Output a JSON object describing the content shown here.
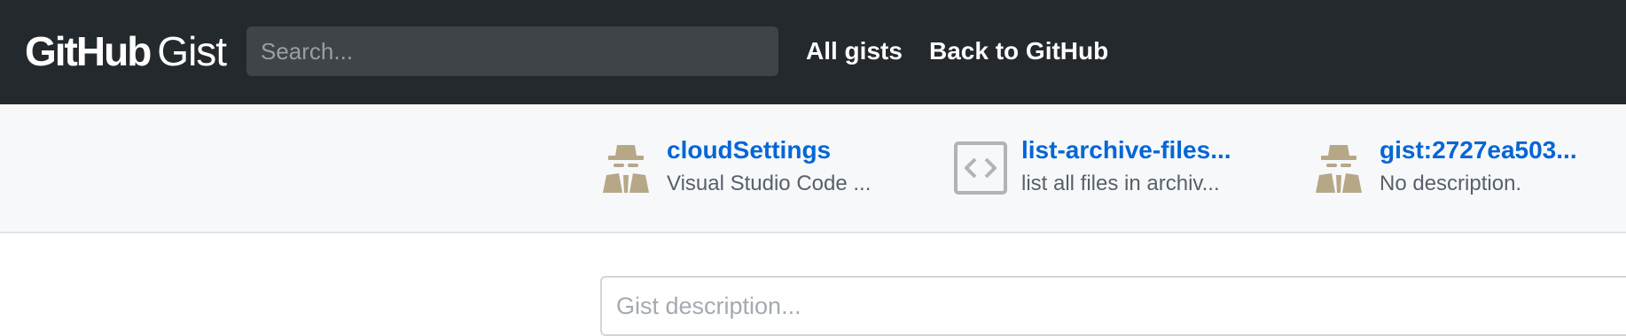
{
  "header": {
    "logo_primary": "GitHub",
    "logo_secondary": "Gist",
    "search_placeholder": "Search...",
    "nav": {
      "all_gists": "All gists",
      "back_to_github": "Back to GitHub"
    }
  },
  "recent_gists": [
    {
      "title": "cloudSettings",
      "description": "Visual Studio Code ...",
      "icon": "anonymous-user-icon"
    },
    {
      "title": "list-archive-files...",
      "description": "list all files in archiv...",
      "icon": "code-file-icon"
    },
    {
      "title": "gist:2727ea503...",
      "description": "No description.",
      "icon": "anonymous-user-icon"
    }
  ],
  "form": {
    "description_placeholder": "Gist description..."
  },
  "colors": {
    "header_bg": "#24292e",
    "strip_bg": "#f6f8fa",
    "link": "#0366d6",
    "icon_tan": "#b6a887"
  }
}
